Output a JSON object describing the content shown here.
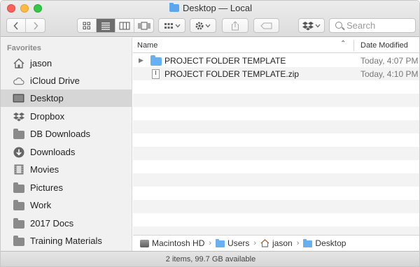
{
  "window": {
    "title": "Desktop — Local"
  },
  "toolbar": {
    "search_placeholder": "Search"
  },
  "sidebar": {
    "section_title": "Favorites",
    "items": [
      {
        "label": "jason",
        "icon": "home-icon"
      },
      {
        "label": "iCloud Drive",
        "icon": "cloud-icon"
      },
      {
        "label": "Desktop",
        "icon": "desktop-icon",
        "selected": true
      },
      {
        "label": "Dropbox",
        "icon": "dropbox-icon"
      },
      {
        "label": "DB Downloads",
        "icon": "folder-icon"
      },
      {
        "label": "Downloads",
        "icon": "download-icon"
      },
      {
        "label": "Movies",
        "icon": "film-icon"
      },
      {
        "label": "Pictures",
        "icon": "folder-icon"
      },
      {
        "label": "Work",
        "icon": "folder-icon"
      },
      {
        "label": "2017 Docs",
        "icon": "folder-icon"
      },
      {
        "label": "Training Materials",
        "icon": "folder-icon"
      }
    ]
  },
  "list": {
    "columns": {
      "name": "Name",
      "date": "Date Modified"
    },
    "files": [
      {
        "name": "PROJECT FOLDER TEMPLATE",
        "date": "Today, 4:07 PM",
        "type": "folder"
      },
      {
        "name": "PROJECT FOLDER TEMPLATE.zip",
        "date": "Today, 4:10 PM",
        "type": "zip"
      }
    ]
  },
  "pathbar": {
    "crumbs": [
      "Macintosh HD",
      "Users",
      "jason",
      "Desktop"
    ]
  },
  "status": {
    "text": "2 items, 99.7 GB available"
  },
  "colors": {
    "folder_blue": "#69b0f0",
    "selected_bg": "#d6d6d6",
    "close": "#fc605c",
    "minimize": "#fdbc40",
    "maximize": "#34c84a"
  }
}
